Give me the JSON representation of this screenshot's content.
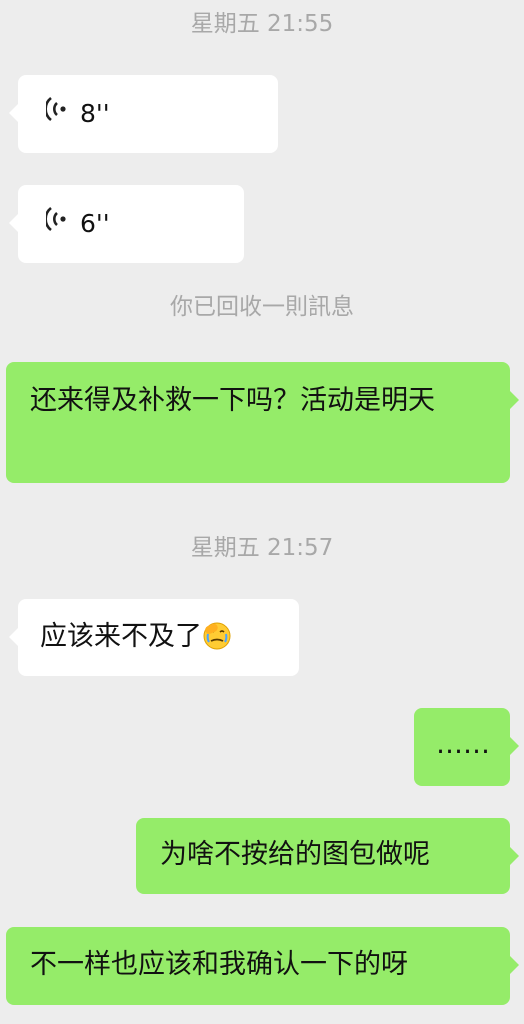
{
  "chat": {
    "timestamp_1": "星期五 21:55",
    "voice_1_duration": "8''",
    "voice_2_duration": "6''",
    "recall_notice": "你已回收一則訊息",
    "msg_out_1": "还来得及补救一下吗？活动是明天",
    "timestamp_2": "星期五 21:57",
    "msg_in_1": "应该来不及了",
    "msg_in_1_emoji": "facepalm-crying-emoji",
    "msg_out_2": "……",
    "msg_out_3": "为啥不按给的图包做呢",
    "msg_out_4": "不一样也应该和我确认一下的呀"
  },
  "colors": {
    "background": "#ededed",
    "incoming_bubble": "#ffffff",
    "outgoing_bubble": "#95ec69",
    "system_text": "#a8a8a8"
  }
}
